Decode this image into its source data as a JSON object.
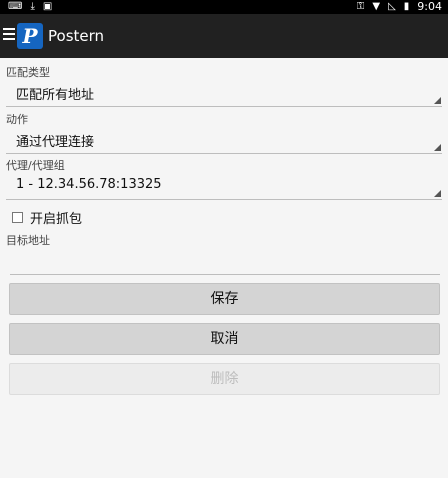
{
  "status_bar": {
    "time": "9:04",
    "left_icons": [
      "keyboard-icon",
      "download-icon",
      "notification-a-icon"
    ],
    "right_icons": [
      "key-icon",
      "wifi-icon",
      "no-signal-icon",
      "battery-icon"
    ]
  },
  "app_bar": {
    "title": "Postern",
    "logo_letter": "P"
  },
  "form": {
    "match_type": {
      "label": "匹配类型",
      "value": "匹配所有地址"
    },
    "action": {
      "label": "动作",
      "value": "通过代理连接"
    },
    "proxy": {
      "label": "代理/代理组",
      "value": "1 - 12.34.56.78:13325"
    },
    "capture": {
      "label": "开启抓包",
      "checked": false
    },
    "target": {
      "label": "目标地址",
      "value": ""
    }
  },
  "buttons": {
    "save": "保存",
    "cancel": "取消",
    "delete": "删除"
  },
  "colors": {
    "app_bar": "#212121",
    "logo": "#1565c0",
    "background": "#f5f5f5",
    "button": "#d4d4d4",
    "button_disabled_text": "#bdbdbd"
  }
}
